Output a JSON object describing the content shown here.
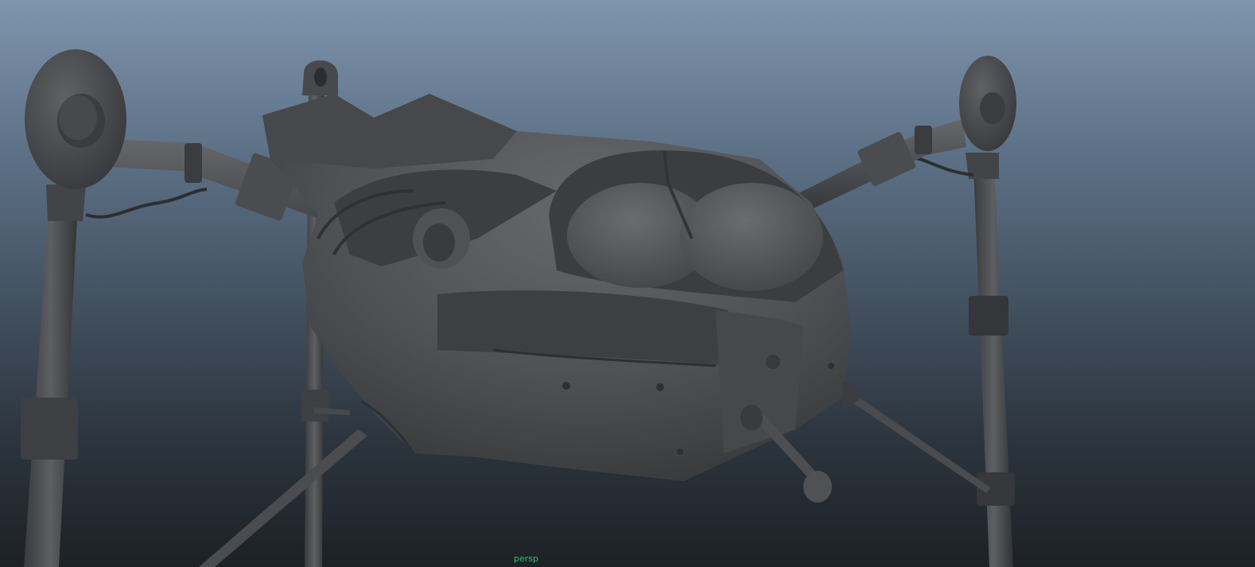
{
  "viewport": {
    "camera_label": "persp",
    "object": "tripod-walker-model",
    "shading": "smooth-shaded-gray"
  },
  "colors": {
    "background_top": "#7f95ad",
    "background_bottom": "#1c2126",
    "model_gray": "#4b4d50",
    "model_dark": "#2a2b2d",
    "model_highlight": "#6d6f73",
    "camera_label": "#2fc46a"
  }
}
